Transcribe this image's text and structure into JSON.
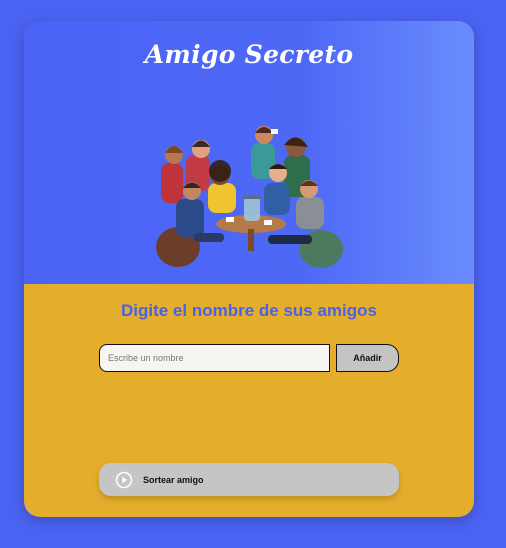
{
  "header": {
    "title": "Amigo Secreto",
    "hero_icon": "friends-party-illustration"
  },
  "main": {
    "subtitle": "Digite el nombre de sus amigos",
    "name_input": {
      "placeholder": "Escribe un nombre",
      "value": ""
    },
    "add_button_label": "Añadir",
    "draw_button": {
      "label": "Sortear amigo",
      "icon": "play-icon"
    }
  },
  "colors": {
    "page_background": "#4b63f3",
    "header_gradient_start": "#4a63f5",
    "header_gradient_end": "#6a8cfd",
    "body_background": "#e4ad2b",
    "subtitle_color": "#4a62e8",
    "button_gray": "#c4c4c4"
  }
}
